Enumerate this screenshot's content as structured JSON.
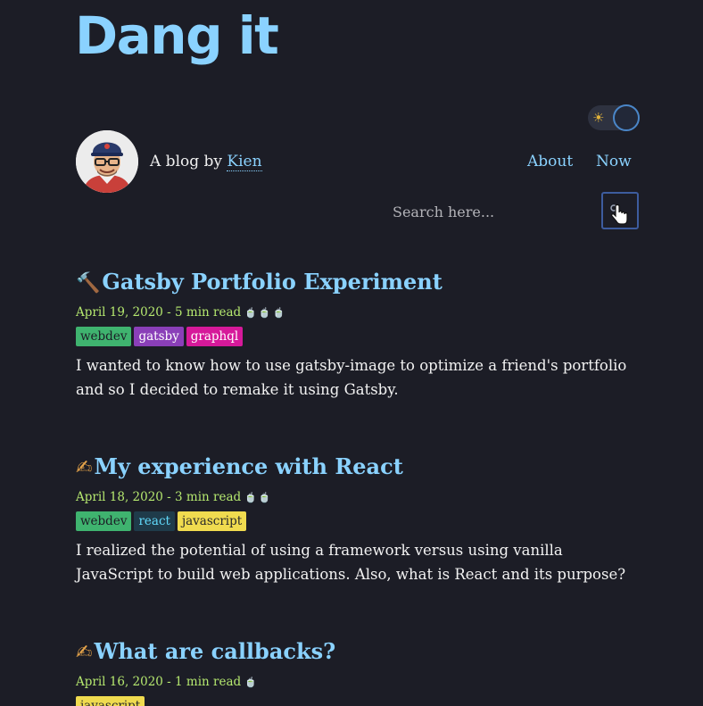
{
  "site": {
    "title": "Dang it",
    "byline_prefix": "A blog by ",
    "author": "Kien"
  },
  "theme_toggle": {
    "icon": "sun-icon",
    "state": "dark"
  },
  "nav": {
    "items": [
      {
        "label": "About"
      },
      {
        "label": "Now"
      }
    ]
  },
  "search": {
    "placeholder": "Search here...",
    "value": "",
    "button_icon": "search-icon"
  },
  "colors": {
    "accent": "#8ad2ff",
    "meta": "#b5e86f",
    "background": "#1c1d26"
  },
  "posts": [
    {
      "emoji": "🔨",
      "emoji_icon": "hammer-icon",
      "title": "Gatsby Portfolio Experiment",
      "date": "April 19, 2020",
      "read_time": "5 min read",
      "cups": "🍵🍵🍵",
      "tags": [
        {
          "label": "webdev",
          "bg": "#3fb36f",
          "fg": "#1c1d26"
        },
        {
          "label": "gatsby",
          "bg": "#8a3fb8",
          "fg": "#ffffff"
        },
        {
          "label": "graphql",
          "bg": "#d6199a",
          "fg": "#ffffff"
        }
      ],
      "excerpt": "I wanted to know how to use gatsby-image to optimize a friend's portfolio and so I decided to remake it using Gatsby."
    },
    {
      "emoji": "✍",
      "emoji_icon": "writing-hand-icon",
      "title": "My experience with React",
      "date": "April 18, 2020",
      "read_time": "3 min read",
      "cups": "🍵🍵",
      "tags": [
        {
          "label": "webdev",
          "bg": "#3fb36f",
          "fg": "#1c1d26"
        },
        {
          "label": "react",
          "bg": "#1f3b4a",
          "fg": "#61dafb"
        },
        {
          "label": "javascript",
          "bg": "#f0db4f",
          "fg": "#2a2a2a"
        }
      ],
      "excerpt": "I realized the potential of using a framework versus using vanilla JavaScript to build web applications. Also, what is React and its purpose?"
    },
    {
      "emoji": "✍",
      "emoji_icon": "writing-hand-icon",
      "title": "What are callbacks?",
      "date": "April 16, 2020",
      "read_time": "1 min read",
      "cups": "🍵",
      "tags": [
        {
          "label": "javascript",
          "bg": "#f0db4f",
          "fg": "#2a2a2a"
        }
      ],
      "excerpt": ""
    }
  ]
}
